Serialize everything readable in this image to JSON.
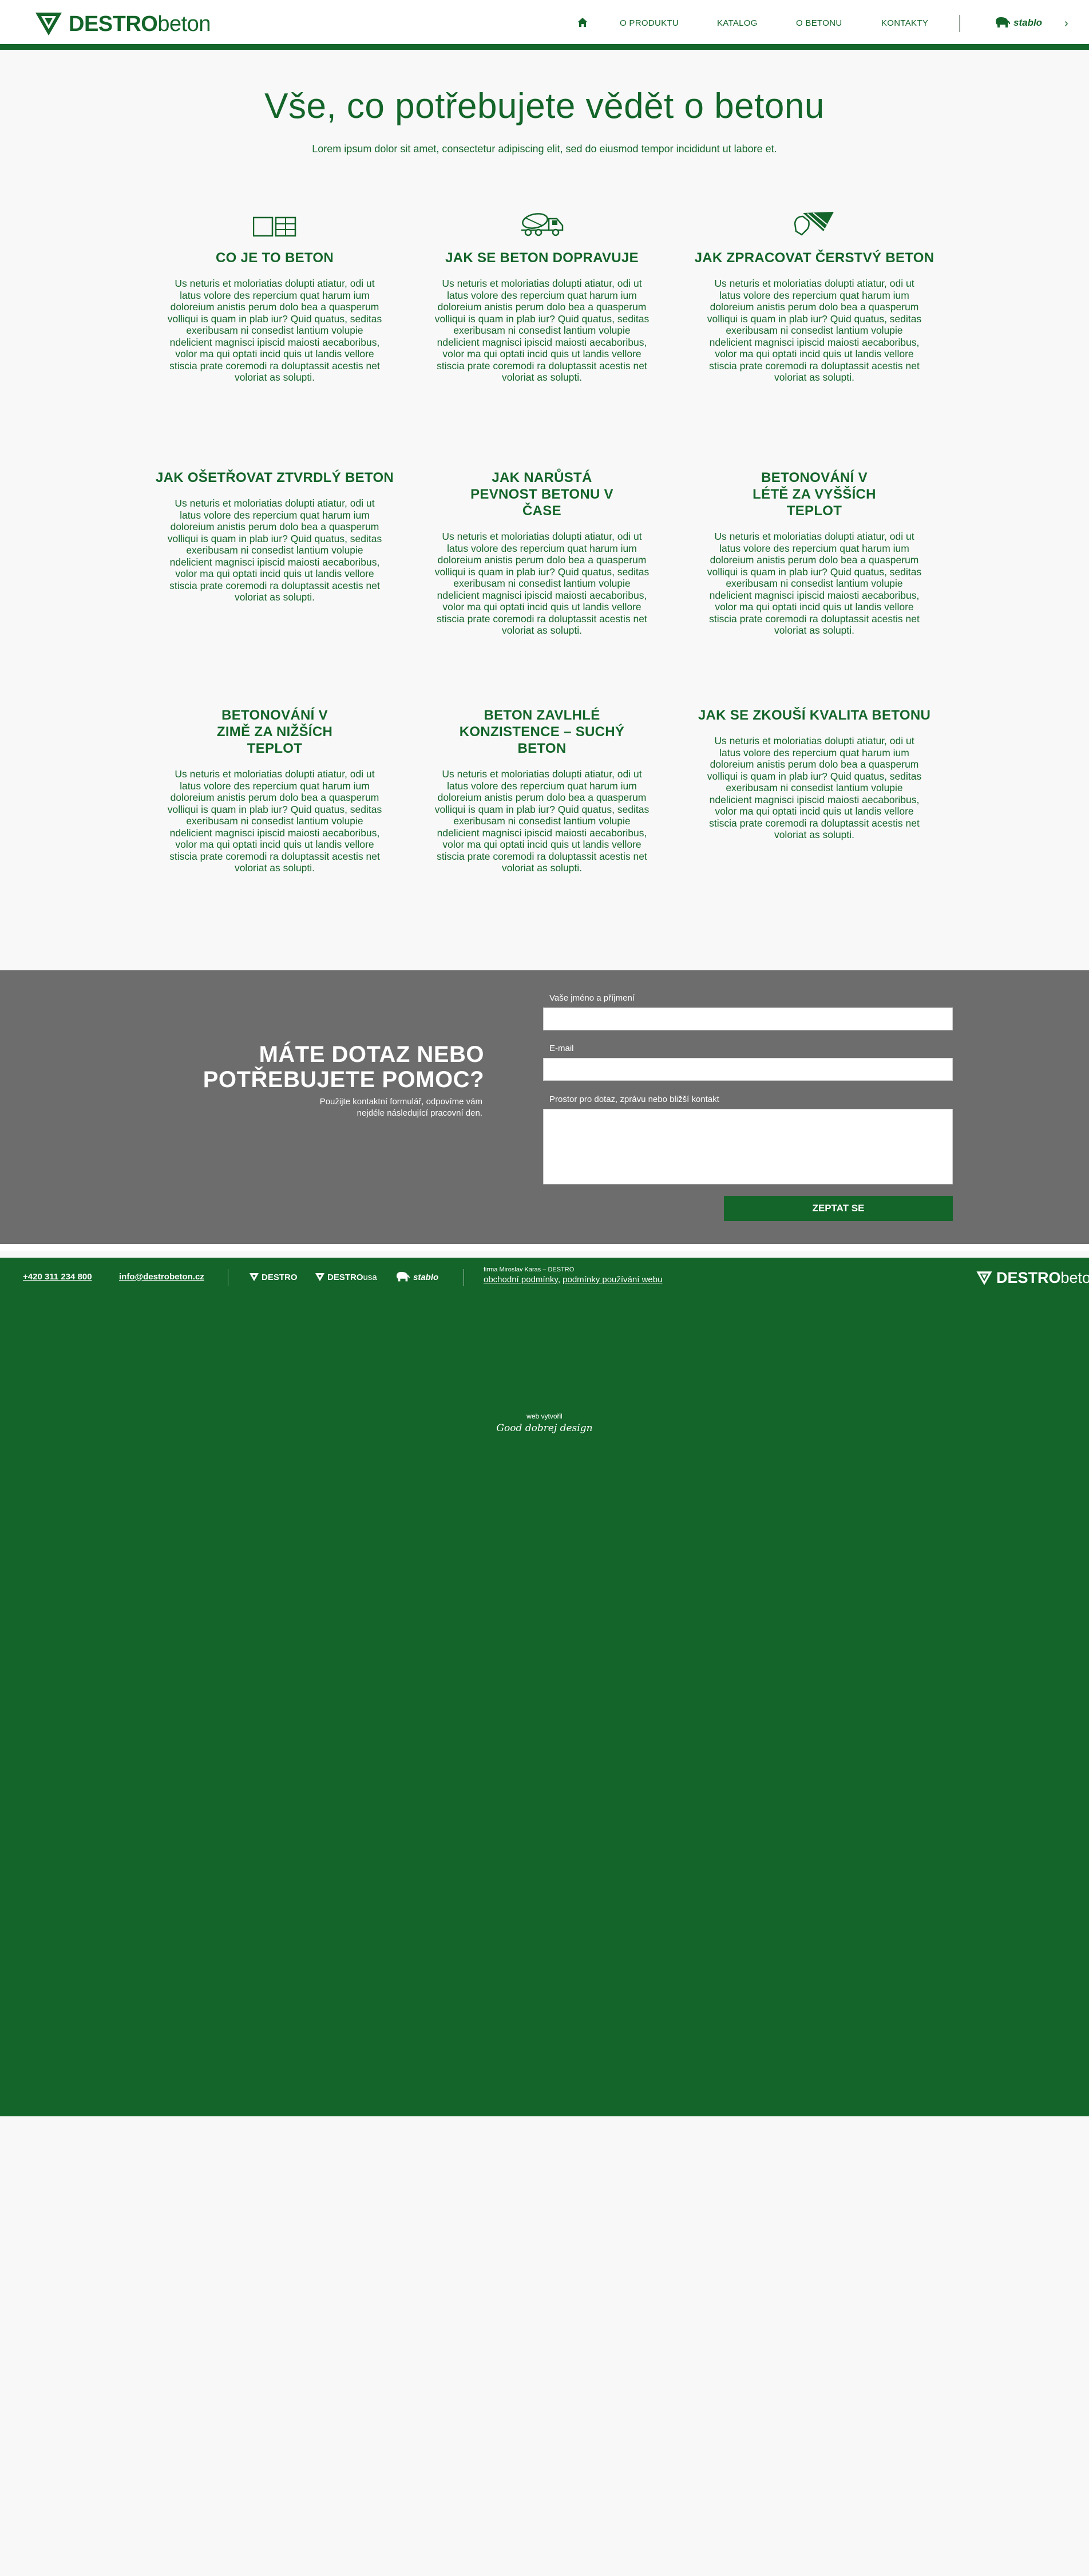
{
  "header": {
    "logo_brand_bold": "DESTRO",
    "logo_brand_light": "beton",
    "nav": [
      {
        "label": "O PRODUKTU"
      },
      {
        "label": "KATALOG"
      },
      {
        "label": "O BETONU"
      },
      {
        "label": "KONTAKTY"
      }
    ],
    "stablo_label": "stablo",
    "chevron": "›"
  },
  "intro": {
    "title": "Vše, co potřebujete vědět o betonu",
    "subtitle": "Lorem ipsum dolor sit amet, consectetur adipiscing elit, sed do eiusmod tempor incididunt ut labore et."
  },
  "topics": [
    {
      "title": "CO JE TO BETON",
      "icon": "concrete-blocks-icon",
      "body": "Us neturis et moloriatias dolupti atiatur, odi ut latus volore des repercium quat harum ium doloreium anistis perum dolo bea a quasperum volliqui is quam in plab iur? Quid quatus, seditas exeribusam ni consedist lantium volupie ndelicient magnisci ipiscid maiosti aecaboribus, volor ma qui optati incid quis ut landis vellore stiscia prate coremodi ra doluptassit acestis net voloriat as solupti."
    },
    {
      "title": "JAK SE BETON DOPRAVUJE",
      "icon": "concrete-mixer-truck-icon",
      "body": "Us neturis et moloriatias dolupti atiatur, odi ut latus volore des repercium quat harum ium doloreium anistis perum dolo bea a quasperum volliqui is quam in plab iur? Quid quatus, seditas exeribusam ni consedist lantium volupie ndelicient magnisci ipiscid maiosti aecaboribus, volor ma qui optati incid quis ut landis vellore stiscia prate coremodi ra doluptassit acestis net voloriat as solupti."
    },
    {
      "title": "JAK ZPRACOVAT ČERSTVÝ BETON",
      "icon": "trowel-hand-icon",
      "body": "Us neturis et moloriatias dolupti atiatur, odi ut latus volore des repercium quat harum ium doloreium anistis perum dolo bea a quasperum volliqui is quam in plab iur? Quid quatus, seditas exeribusam ni consedist lantium volupie ndelicient magnisci ipiscid maiosti aecaboribus, volor ma qui optati incid quis ut landis vellore stiscia prate coremodi ra doluptassit acestis net voloriat as solupti."
    },
    {
      "title": "JAK OŠETŘOVAT ZTVRDLÝ BETON",
      "body": "Us neturis et moloriatias dolupti atiatur, odi ut latus volore des repercium quat harum ium doloreium anistis perum dolo bea a quasperum volliqui is quam in plab iur? Quid quatus, seditas exeribusam ni consedist lantium volupie ndelicient magnisci ipiscid maiosti aecaboribus, volor ma qui optati incid quis ut landis vellore stiscia prate coremodi ra doluptassit acestis net voloriat as solupti."
    },
    {
      "title": "JAK NARŮSTÁ PEVNOST BETONU V ČASE",
      "body": "Us neturis et moloriatias dolupti atiatur, odi ut latus volore des repercium quat harum ium doloreium anistis perum dolo bea a quasperum volliqui is quam in plab iur? Quid quatus, seditas exeribusam ni consedist lantium volupie ndelicient magnisci ipiscid maiosti aecaboribus, volor ma qui optati incid quis ut landis vellore stiscia prate coremodi ra doluptassit acestis net voloriat as solupti."
    },
    {
      "title": "BETONOVÁNÍ V LÉTĚ ZA VYŠŠÍCH TEPLOT",
      "body": "Us neturis et moloriatias dolupti atiatur, odi ut latus volore des repercium quat harum ium doloreium anistis perum dolo bea a quasperum volliqui is quam in plab iur? Quid quatus, seditas exeribusam ni consedist lantium volupie ndelicient magnisci ipiscid maiosti aecaboribus, volor ma qui optati incid quis ut landis vellore stiscia prate coremodi ra doluptassit acestis net voloriat as solupti."
    },
    {
      "title": "BETONOVÁNÍ V ZIMĚ ZA NIŽŠÍCH TEPLOT",
      "body": "Us neturis et moloriatias dolupti atiatur, odi ut latus volore des repercium quat harum ium doloreium anistis perum dolo bea a quasperum volliqui is quam in plab iur? Quid quatus, seditas exeribusam ni consedist lantium volupie ndelicient magnisci ipiscid maiosti aecaboribus, volor ma qui optati incid quis ut landis vellore stiscia prate coremodi ra doluptassit acestis net voloriat as solupti."
    },
    {
      "title": "BETON ZAVLHLÉ KONZISTENCE – SUCHÝ BETON",
      "body": "Us neturis et moloriatias dolupti atiatur, odi ut latus volore des repercium quat harum ium doloreium anistis perum dolo bea a quasperum volliqui is quam in plab iur? Quid quatus, seditas exeribusam ni consedist lantium volupie ndelicient magnisci ipiscid maiosti aecaboribus, volor ma qui optati incid quis ut landis vellore stiscia prate coremodi ra doluptassit acestis net voloriat as solupti."
    },
    {
      "title": "JAK SE ZKOUŠÍ KVALITA BETONU",
      "body": "Us neturis et moloriatias dolupti atiatur, odi ut latus volore des repercium quat harum ium doloreium anistis perum dolo bea a quasperum volliqui is quam in plab iur? Quid quatus, seditas exeribusam ni consedist lantium volupie ndelicient magnisci ipiscid maiosti aecaboribus, volor ma qui optati incid quis ut landis vellore stiscia prate coremodi ra doluptassit acestis net voloriat as solupti."
    }
  ],
  "contact": {
    "heading_line1": "MÁTE DOTAZ NEBO",
    "heading_line2": "POTŘEBUJETE POMOC?",
    "note": "Použijte kontaktní formulář, odpovíme vám nejdéle následující pracovní den.",
    "name_label": "Vaše jméno a příjmení",
    "name_value": "",
    "email_label": "E-mail",
    "email_value": "",
    "message_label": "Prostor pro dotaz, zprávu nebo bližší kontakt",
    "message_value": "",
    "submit_label": "ZEPTAT SE"
  },
  "footer": {
    "phone": "+420 311 234 800",
    "email": "info@destrobeton.cz",
    "brand_destro": "DESTRO",
    "brand_destro_usa_bold": "DESTRO",
    "brand_destro_usa_light": "usa",
    "brand_stablo": "stablo",
    "company": "firma Miroslav Karas – DESTRO",
    "terms_link_1": "obchodní podmínky",
    "terms_sep": ", ",
    "terms_link_2": "podmínky používání webu",
    "logo_bold": "DESTRO",
    "logo_light": "beton",
    "made_by_label": "web vytvořil",
    "made_by_signature": "Good dobrej design"
  },
  "colors": {
    "brand_green": "#14652a",
    "contact_bg": "#6c6d6c",
    "page_bg": "#f8f8f8"
  }
}
